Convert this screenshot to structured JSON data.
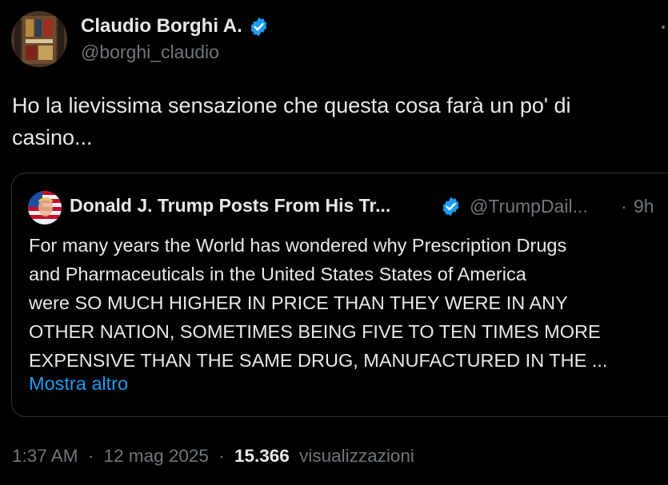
{
  "author": {
    "display_name": "Claudio Borghi A.",
    "handle": "@borghi_claudio",
    "verified_icon": "verified-badge-icon",
    "avatar_icon": "profile-avatar"
  },
  "tweet": {
    "text_line1": "Ho la lievissima sensazione che questa cosa farà un po' di",
    "text_line2": "casino..."
  },
  "quote": {
    "display_name": "Donald J. Trump Posts From His Tr...",
    "handle": "@TrumpDail...",
    "separator": "·",
    "time": "9h",
    "lines": [
      "For many years the World has wondered why Prescription Drugs",
      "and Pharmaceuticals in the United States States of America",
      "were SO MUCH HIGHER IN PRICE THAN THEY WERE IN ANY",
      "OTHER NATION, SOMETIMES BEING FIVE TO TEN TIMES MORE",
      "EXPENSIVE THAN THE SAME DRUG, MANUFACTURED IN THE ..."
    ],
    "show_more": "Mostra altro"
  },
  "meta": {
    "time": "1:37 AM",
    "sep1": "·",
    "date": "12 mag 2025",
    "sep2": "·",
    "views_count": "15.366",
    "views_label": "visualizzazioni"
  },
  "colors": {
    "background": "#000000",
    "text": "#e7e9ea",
    "secondary": "#71767b",
    "link": "#1d9bf0",
    "border": "#2f3336"
  }
}
